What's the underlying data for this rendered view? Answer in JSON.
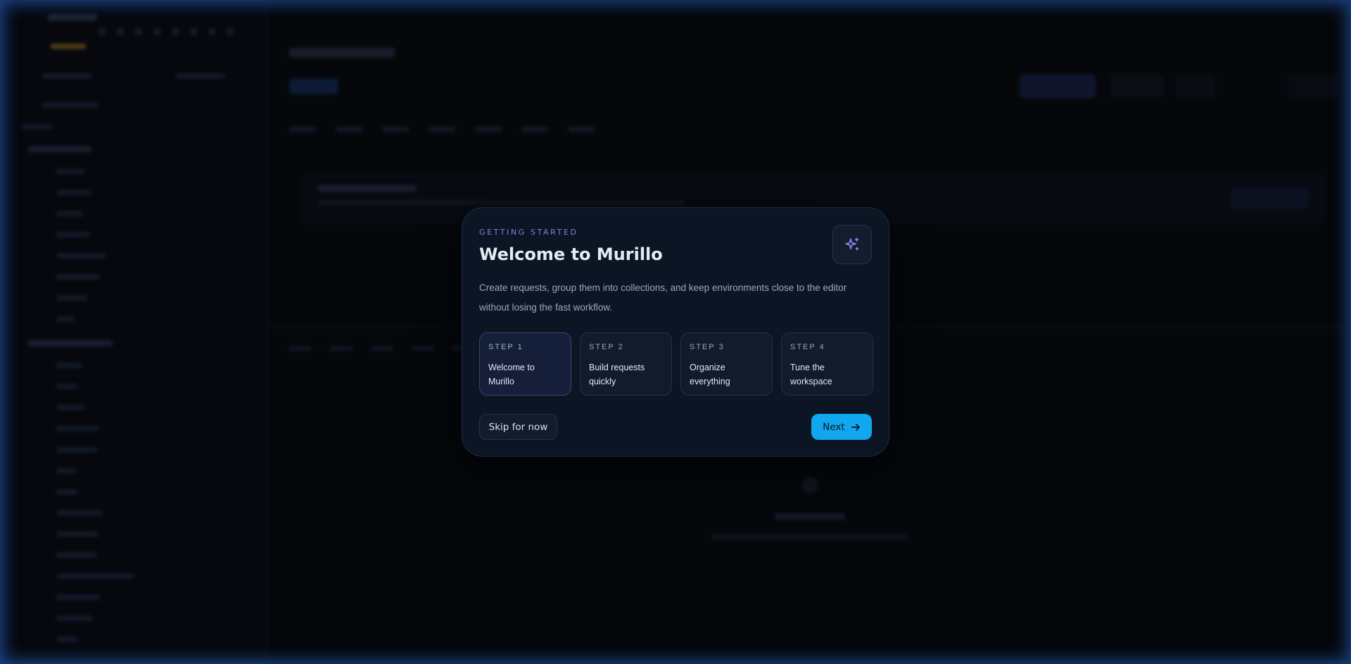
{
  "onboarding": {
    "eyebrow": "GETTING STARTED",
    "title": "Welcome to Murillo",
    "description": "Create requests, group them into collections, and keep environments close to the editor without losing the fast workflow.",
    "icon": "sparkles-icon",
    "current_step": 1,
    "steps": [
      {
        "label": "STEP 1",
        "title": "Welcome to Murillo"
      },
      {
        "label": "STEP 2",
        "title": "Build requests quickly"
      },
      {
        "label": "STEP 3",
        "title": "Organize everything"
      },
      {
        "label": "STEP 4",
        "title": "Tune the workspace"
      }
    ],
    "skip_label": "Skip for now",
    "next_label": "Next",
    "next_icon": "arrow-right-icon"
  },
  "colors": {
    "accent": "#11a7ee",
    "eyebrow": "#7b84d6",
    "modal_bg": "#0c1524"
  }
}
